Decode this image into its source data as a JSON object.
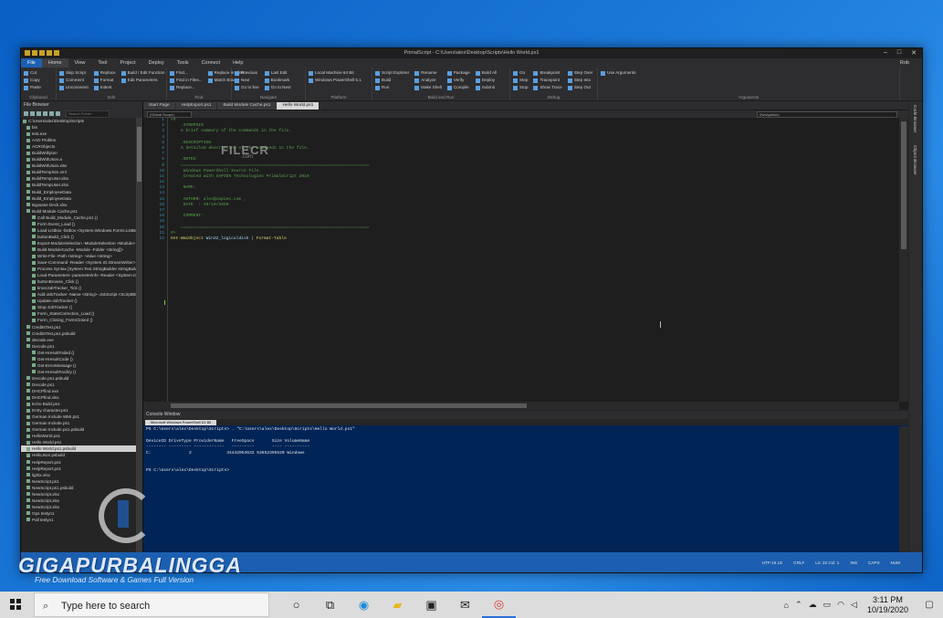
{
  "window": {
    "title": "PrimalScript - C:\\Users\\alex\\Desktop\\Scripts\\Hello World.ps1",
    "account_label": "Rob"
  },
  "menu": [
    "File",
    "Home",
    "View",
    "Tool",
    "Project",
    "Deploy",
    "Tools",
    "Connect",
    "Help"
  ],
  "ribbon": {
    "groups": [
      {
        "label": "Clipboard",
        "items": [
          "Cut",
          "Copy",
          "Paste"
        ]
      },
      {
        "label": "Edit",
        "items": [
          "Skip Script",
          "Comment",
          "Uncomment",
          "Replace",
          "Format",
          "Indent",
          "Build / Edit Function",
          "Edit Parameters"
        ]
      },
      {
        "label": "Find",
        "items": [
          "Find...",
          "Find in Files...",
          "Replace...",
          "Replace in Files...",
          "Match Brace"
        ]
      },
      {
        "label": "Navigate",
        "items": [
          "Previous",
          "Next",
          "Go to line",
          "Last Edit",
          "Bookmark",
          "Go to Next"
        ]
      },
      {
        "label": "Platform",
        "items": [
          "Local Machine 64 Bit",
          "Windows PowerShell 5.1"
        ]
      },
      {
        "label": "Build and Run",
        "items": [
          "Script Explorer",
          "Build",
          "Run",
          "Rename",
          "Analyze",
          "Make Shell",
          "Package",
          "Verify",
          "Compile",
          "Build All",
          "Deploy",
          "Submit"
        ]
      },
      {
        "label": "Debug",
        "items": [
          "Go",
          "Step",
          "Stop",
          "Breakpoint",
          "Tracepoint",
          "Show Trace",
          "Step Over",
          "Step Into",
          "Step Out"
        ]
      },
      {
        "label": "Arguments",
        "items": [
          "Use Arguments"
        ]
      }
    ]
  },
  "file_browser": {
    "title": "File Browser",
    "search_placeholder": "Search Folder",
    "items": [
      "C:\\Users\\alex\\Desktop\\Scripts",
      "bin",
      "test.exe",
      "AAD Profiles",
      "ACRObjects",
      "BuildWithjson",
      "BuildWithJson.a",
      "BuildWithJson.xlsx",
      "BuildTempSim.xml",
      "BuildTempUser.xlsx",
      "BuildTempUser.xlsx",
      "Build_EmployeeData",
      "Build_EmployeeData",
      "Bypasse Deck.xlsx",
      "Build Module Cache.ps1",
      "Call Build_Module_Cache.ps1 ()",
      "Form Event_Load ()",
      "Load-Listbox -listbox <System.Windows.Forms.ListBox>",
      "buttonBuild_Click ()",
      "Export-ModuleSelection -ModuleSelection <Module>",
      "Build-ModuleCache -Module -Folder <string[]>",
      "Write-File -Path <string> -Value <string>",
      "Save-Command -Reader <System.IO.StreamWriter>",
      "Process Syntax [System.Text.StringBuilder stringBuilder]",
      "Load-Parameters -parameterinfo -Reader <System.IO>",
      "buttonBrowse_Click ()",
      "timerJobTracker_Tick ()",
      "Add-JobTracker -Name <string> -JobScript <ScriptBlock>",
      "Update-JobTracker ()",
      "Stop-JobTracker ()",
      "Form_StateCorrection_Load ()",
      "Form_Closing_FormClosed ()",
      "CreditsTest.ps1",
      "CreditsTest.ps1.psbuild",
      "decode.exe",
      "Decode.ps1",
      "Get-HresultFailed ()",
      "Get-HresultCode ()",
      "Get-ErrorMessage ()",
      "Get-HresultFacility ()",
      "Decode.ps1.psbuild",
      "Decode.ps1",
      "DHCPfind.exe",
      "DHCPfind.xlsx",
      "Echo Build.ps1",
      "Entry character.ps1",
      "German Include WMI.ps1",
      "German Include.ps1",
      "German Include.ps1.psbuild",
      "HelloWorld.ps1",
      "Hello World.ps1",
      "Hello World.ps1.psbuild",
      "HelloJson.psbuild",
      "HelpReport.ps1",
      "HelpReport.ps1",
      "lightx.xlsx",
      "NewScript.ps1",
      "NewScript.ps1.psbuild",
      "NewScript.xlsx",
      "NewScript.xlsx",
      "NewScript.xlsx",
      "Ops testyn1",
      "Pall testyn1"
    ],
    "selected_index": 51
  },
  "editor": {
    "tabs": [
      "Start Page",
      "HelpExport.ps1",
      "Build Module Cache.ps1",
      "Hello World.ps1"
    ],
    "active_tab": 3,
    "nav_left": "(Global Scope)",
    "nav_right": "(Navigation)",
    "line_numbers": [
      "1",
      "2",
      "3",
      "4",
      "5",
      "6",
      "7",
      "8",
      "9",
      "10",
      "11",
      "12",
      "13",
      "14",
      "15",
      "16",
      "17",
      "18",
      "19",
      "20",
      "21",
      "22"
    ],
    "lines": [
      {
        "t": "<#",
        "c": "cmt"
      },
      {
        "t": "    .SYNOPSIS",
        "c": "cmt"
      },
      {
        "t": "    A brief summary of the commands in the file.",
        "c": "cmt"
      },
      {
        "t": "",
        "c": "cmt"
      },
      {
        "t": "    .DESCRIPTION",
        "c": "cmt"
      },
      {
        "t": "    A detailed description of the commands in the file.",
        "c": "cmt"
      },
      {
        "t": "",
        "c": "cmt"
      },
      {
        "t": "    .NOTES",
        "c": "cmt"
      },
      {
        "t": "    ===========================================================================",
        "c": "cmt"
      },
      {
        "t": "     Windows PowerShell Source File",
        "c": "cmt"
      },
      {
        "t": "     Created with SAPIEN Technologies PrimalScript 2019",
        "c": "cmt"
      },
      {
        "t": "",
        "c": "cmt"
      },
      {
        "t": "     NAME:",
        "c": "cmt"
      },
      {
        "t": "",
        "c": "cmt"
      },
      {
        "t": "     AUTHOR: alex@sapien.com ,",
        "c": "cmt"
      },
      {
        "t": "     DATE  : 10/19/2020",
        "c": "cmt"
      },
      {
        "t": "",
        "c": "cmt"
      },
      {
        "t": "     COMMENT:",
        "c": "cmt"
      },
      {
        "t": "",
        "c": "cmt"
      },
      {
        "t": "    ===========================================================================",
        "c": "cmt"
      },
      {
        "t": "#>",
        "c": "cmt"
      },
      {
        "t": "",
        "c": "cmt"
      }
    ],
    "code_cmdlet": "Get-WmiObject",
    "code_class": " Win32_logicaldisk",
    "code_pipe": " | ",
    "code_format": "Format-Table",
    "watermark": "FILECR",
    "watermark_sub": ".com"
  },
  "side_tabs": [
    "Code Browser",
    "Object Browser"
  ],
  "console": {
    "title": "Console Window",
    "tab": "Microsoft Windows PowerShell 64 Bit",
    "lines": [
      "PS C:\\Users\\alex\\Desktop\\Scripts> . \"C:\\Users\\alex\\Desktop\\Scripts\\Hello World.ps1\"",
      "",
      "DeviceID DriveType ProviderName   FreeSpace       Size VolumeName",
      "-------- --------- ------------   ---------       ---- ----------",
      "C:               3              34442053632 53852395520 Windows",
      "",
      "",
      "PS C:\\Users\\alex\\Desktop\\Scripts>"
    ]
  },
  "status": {
    "items": [
      "UTF-16 LE",
      "CRLF",
      "Ln: 22 Col: 1",
      "INS",
      "CAPS",
      "NUM"
    ]
  },
  "watermark_brand": {
    "title": "GIGAPURBALINGGA",
    "subtitle": "Free Download Software & Games Full Version"
  },
  "taskbar": {
    "search_placeholder": "Type here to search",
    "time": "3:11 PM",
    "date": "10/19/2020"
  }
}
